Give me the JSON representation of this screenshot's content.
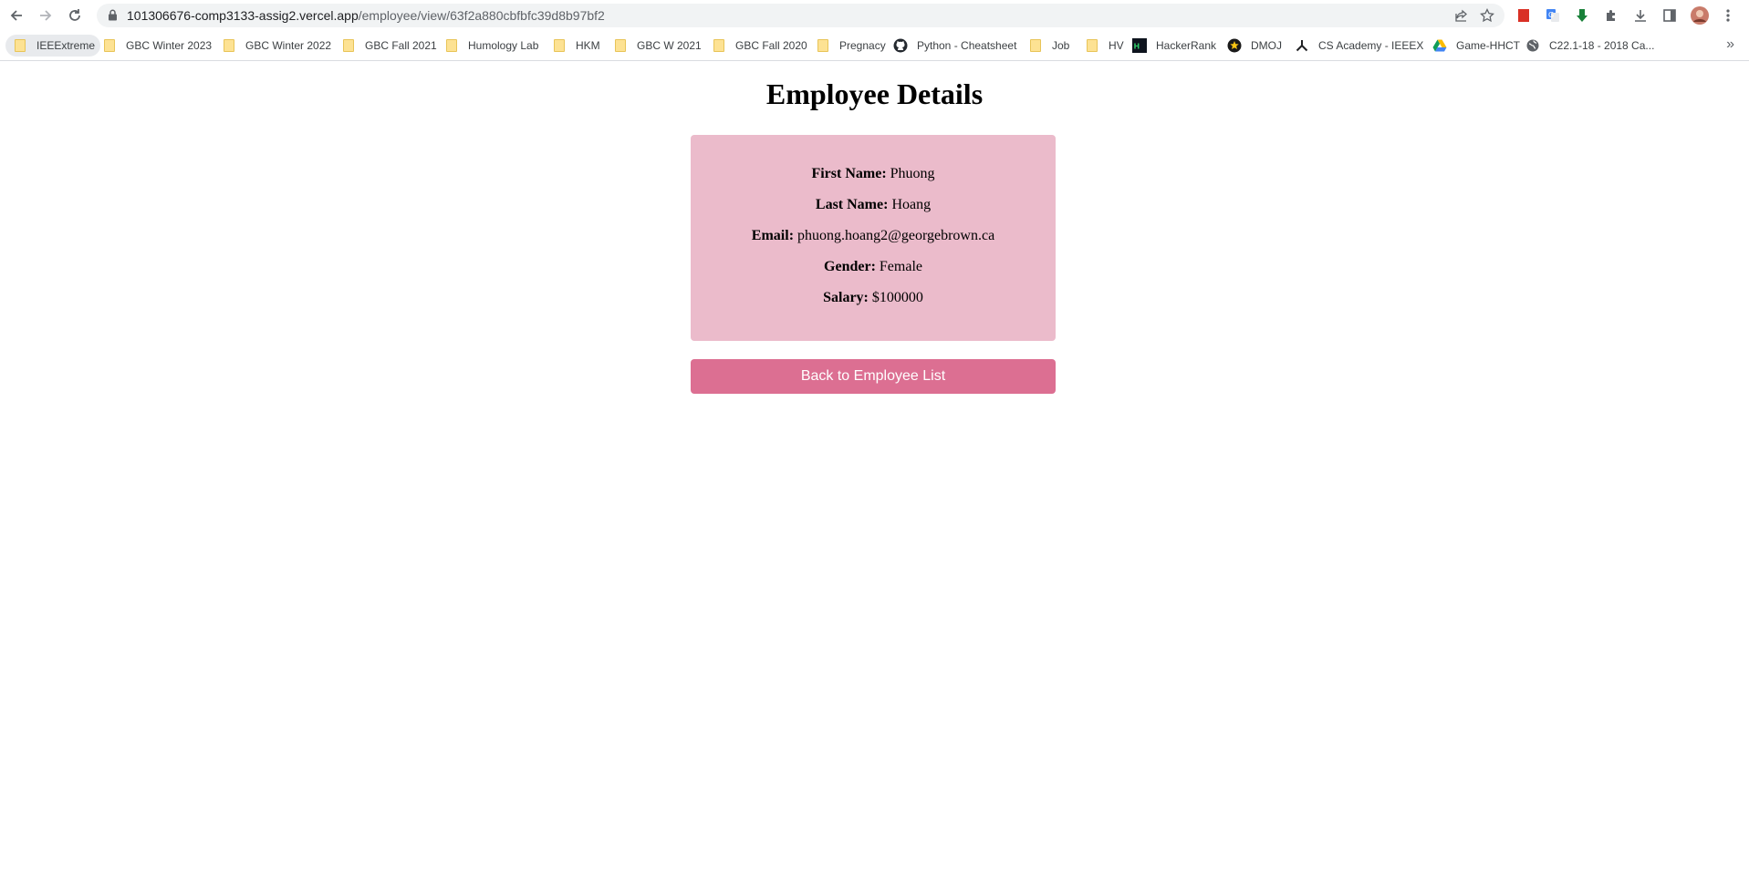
{
  "browser": {
    "url_host": "101306676-comp3133-assig2.vercel.app",
    "url_path": "/employee/view/63f2a880cbfbfc39d8b97bf2",
    "bookmarks": [
      {
        "label": "IEEExtreme",
        "icon": "folder-icon"
      },
      {
        "label": "GBC Winter 2023",
        "icon": "folder-icon"
      },
      {
        "label": "GBC Winter 2022",
        "icon": "folder-icon"
      },
      {
        "label": "GBC Fall 2021",
        "icon": "folder-icon"
      },
      {
        "label": "Humology Lab",
        "icon": "folder-icon"
      },
      {
        "label": "HKM",
        "icon": "folder-icon"
      },
      {
        "label": "GBC W 2021",
        "icon": "folder-icon"
      },
      {
        "label": "GBC Fall 2020",
        "icon": "folder-icon"
      },
      {
        "label": "Pregnacy",
        "icon": "folder-icon"
      },
      {
        "label": "Python - Cheatsheet",
        "icon": "github-icon"
      },
      {
        "label": "Job",
        "icon": "folder-icon"
      },
      {
        "label": "HV",
        "icon": "folder-icon"
      },
      {
        "label": "HackerRank",
        "icon": "hackerrank-icon"
      },
      {
        "label": "DMOJ",
        "icon": "dmoj-icon"
      },
      {
        "label": "CS Academy - IEEEX",
        "icon": "csacademy-icon"
      },
      {
        "label": "Game-HHCT",
        "icon": "google-drive-icon"
      },
      {
        "label": "C22.1-18 - 2018 Ca...",
        "icon": "globe-icon"
      }
    ],
    "more_bookmarks": "»"
  },
  "page": {
    "title": "Employee Details",
    "fields": [
      {
        "label": "First Name:",
        "value": "Phuong"
      },
      {
        "label": "Last Name:",
        "value": "Hoang"
      },
      {
        "label": "Email:",
        "value": "phuong.hoang2@georgebrown.ca"
      },
      {
        "label": "Gender:",
        "value": "Female"
      },
      {
        "label": "Salary:",
        "value": "$100000"
      }
    ],
    "back_button": "Back to Employee List"
  },
  "colors": {
    "card_bg": "#ebbbcb",
    "button_bg": "#dc6f92",
    "button_text": "#ffffff"
  }
}
